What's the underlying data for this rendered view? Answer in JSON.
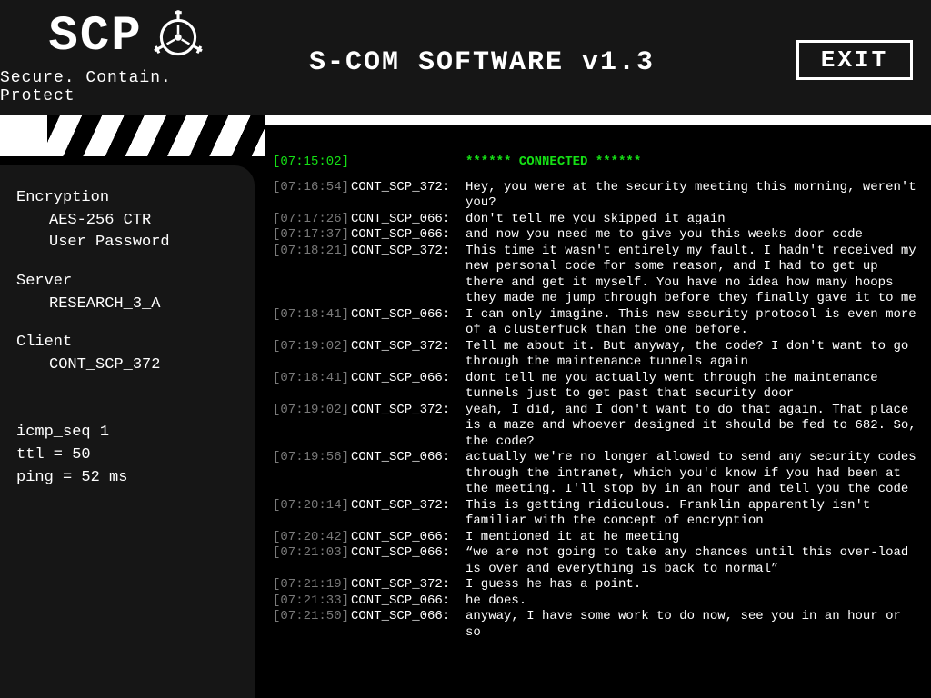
{
  "logo": {
    "text": "SCP",
    "tagline": "Secure. Contain. Protect"
  },
  "header": {
    "title": "S-COM SOFTWARE v1.3",
    "exit": "EXIT"
  },
  "sidebar": {
    "encryption": {
      "label": "Encryption",
      "cipher": "AES-256 CTR",
      "key": "User Password"
    },
    "server": {
      "label": "Server",
      "value": "RESEARCH_3_A"
    },
    "client": {
      "label": "Client",
      "value": "CONT_SCP_372"
    },
    "net": {
      "seq": "icmp_seq 1",
      "ttl": "ttl = 50",
      "ping": "ping = 52 ms"
    }
  },
  "log": [
    {
      "ts": "[07:15:02]",
      "sender": "",
      "msg": "****** CONNECTED ******",
      "connected": true
    },
    {
      "gap": true
    },
    {
      "ts": "[07:16:54]",
      "sender": "CONT_SCP_372:",
      "msg": "Hey, you were at the security meeting this morning, weren't you?"
    },
    {
      "ts": "[07:17:26]",
      "sender": "CONT_SCP_066:",
      "msg": "don't tell me you skipped it again"
    },
    {
      "ts": "[07:17:37]",
      "sender": "CONT_SCP_066:",
      "msg": "and now you need me to give you this weeks door code"
    },
    {
      "ts": "[07:18:21]",
      "sender": "CONT_SCP_372:",
      "msg": "This time it wasn't entirely my fault. I hadn't received my new personal code for some reason, and I had to get up there and get it myself. You have no idea how many hoops they made me jump through before they finally gave it to me"
    },
    {
      "ts": "[07:18:41]",
      "sender": "CONT_SCP_066:",
      "msg": "I can only imagine. This new security protocol is even more of a clusterfuck than the one before."
    },
    {
      "ts": "[07:19:02]",
      "sender": "CONT_SCP_372:",
      "msg": "Tell me about it. But anyway, the code? I don't want to go through the maintenance tunnels again"
    },
    {
      "ts": "[07:18:41]",
      "sender": "CONT_SCP_066:",
      "msg": "dont tell me you actually went through the maintenance tunnels just to get past that security door"
    },
    {
      "ts": "[07:19:02]",
      "sender": "CONT_SCP_372:",
      "msg": "yeah, I did, and I don't want to do that again. That place is a maze and whoever designed it should be fed to 682. So, the code?"
    },
    {
      "ts": "[07:19:56]",
      "sender": "CONT_SCP_066:",
      "msg": "actually we're no longer allowed to send any security codes through the intranet, which you'd know if you had been at the meeting. I'll stop by in an hour and tell you the code"
    },
    {
      "ts": "[07:20:14]",
      "sender": "CONT_SCP_372:",
      "msg": "This is getting ridiculous. Franklin apparently isn't familiar with the concept of encryption"
    },
    {
      "ts": "[07:20:42]",
      "sender": "CONT_SCP_066:",
      "msg": "I mentioned it at he meeting"
    },
    {
      "ts": "[07:21:03]",
      "sender": "CONT_SCP_066:",
      "msg": "“we are not going to take any chances until this over-load is over and everything is back to normal”"
    },
    {
      "ts": "[07:21:19]",
      "sender": "CONT_SCP_372:",
      "msg": "I guess he has a point."
    },
    {
      "ts": "[07:21:33]",
      "sender": "CONT_SCP_066:",
      "msg": "he does."
    },
    {
      "ts": "[07:21:50]",
      "sender": "CONT_SCP_066:",
      "msg": "anyway, I have some work to do now, see you in an hour or so"
    }
  ]
}
